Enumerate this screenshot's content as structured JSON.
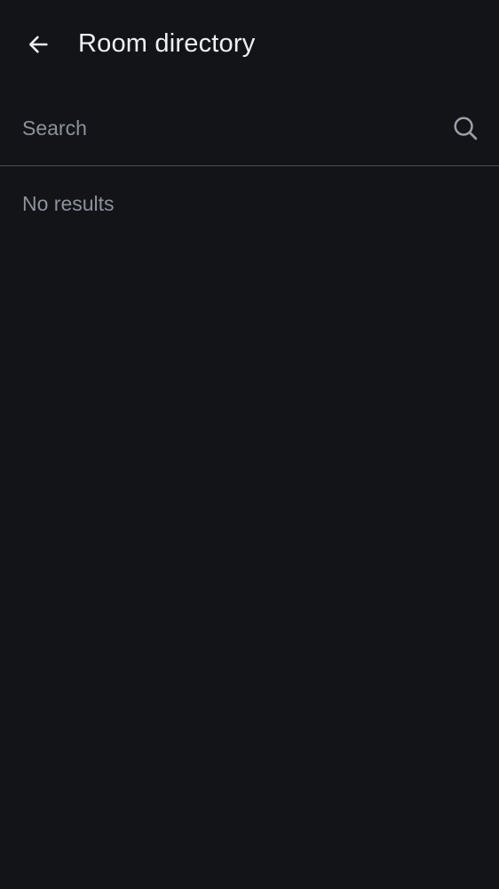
{
  "header": {
    "back_icon": "arrow-left-icon",
    "title": "Room directory"
  },
  "search": {
    "placeholder": "Search",
    "value": "",
    "icon": "search-icon"
  },
  "results": {
    "empty_message": "No results"
  },
  "colors": {
    "background": "#121418",
    "title_text": "#eef0f3",
    "muted_text": "#8d929a",
    "divider": "#4a4e55"
  }
}
